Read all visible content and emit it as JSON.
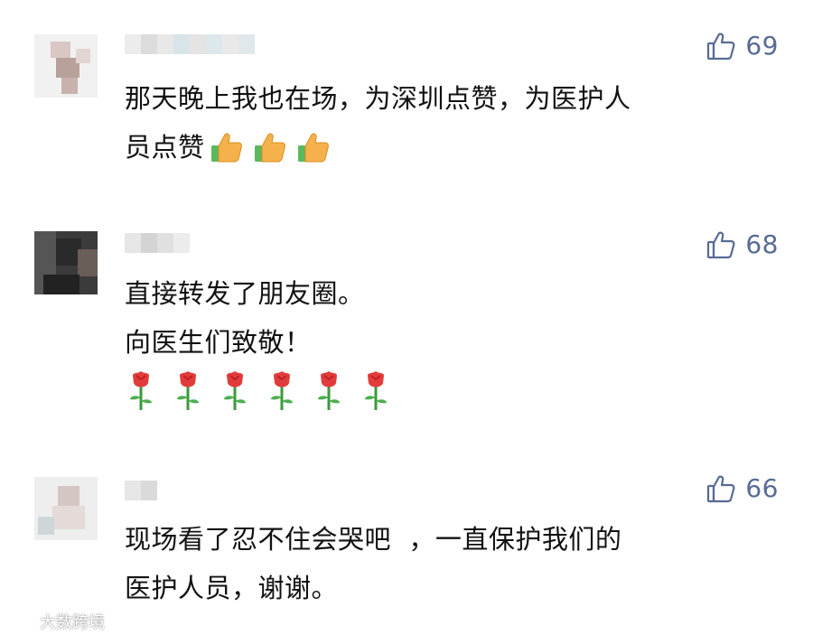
{
  "colors": {
    "accent": "#576b95",
    "text": "#111111",
    "background": "#ffffff"
  },
  "comments": [
    {
      "likes": "69",
      "lines": [
        "那天晚上我也在场，为深圳点赞，为医护人",
        "员点赞"
      ],
      "emoji": [
        "thumbs-up",
        "thumbs-up",
        "thumbs-up"
      ]
    },
    {
      "likes": "68",
      "lines": [
        "直接转发了朋友圈。",
        "向医生们致敬！"
      ],
      "emoji": [
        "rose",
        "rose",
        "rose",
        "rose",
        "rose",
        "rose"
      ]
    },
    {
      "likes": "66",
      "lines": [
        "现场看了忍不住会哭吧  ，一直保护我们的",
        "医护人员，谢谢。"
      ]
    }
  ],
  "icons": {
    "like": "thumbs-up-outline-icon"
  },
  "watermark": {
    "text": "大数跨境"
  }
}
